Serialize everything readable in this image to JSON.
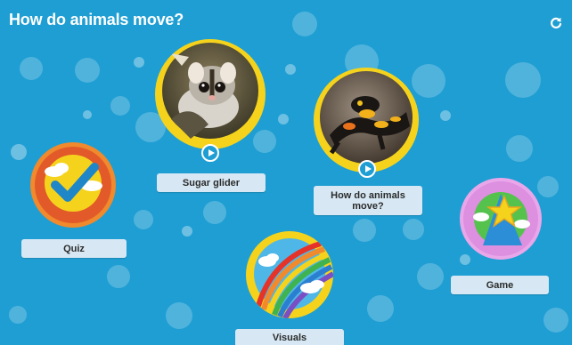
{
  "header": {
    "title": "How do animals move?",
    "refresh_icon": "refresh-icon"
  },
  "activities": {
    "sugar_glider": {
      "label": "Sugar glider",
      "icon": "play-icon"
    },
    "video": {
      "label": "How do animals\nmove?",
      "icon": "play-icon"
    },
    "quiz": {
      "label": "Quiz",
      "icon": "checkmark-icon"
    },
    "visuals": {
      "label": "Visuals",
      "icon": "rainbow-icon"
    },
    "game": {
      "label": "Game",
      "icon": "star-icon"
    }
  },
  "colors": {
    "background": "#1f9ed3",
    "ring_yellow": "#f5d31c",
    "quiz_orange": "#e25a2a",
    "game_purple": "#dd8fe0",
    "label_bg": "#d7e8f4"
  }
}
